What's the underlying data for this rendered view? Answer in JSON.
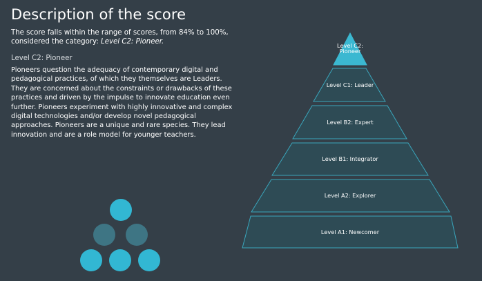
{
  "header": {
    "title": "Description of the score"
  },
  "intro": {
    "line1": "The score falls within the range of scores, from 84% to 100%,",
    "line2_prefix": "considered the category: ",
    "category": "Level C2: Pioneer."
  },
  "level": {
    "heading": "Level C2: Pioneer",
    "description": "Pioneers question the adequacy of contemporary digital and pedagogical practices, of which they themselves are Leaders. They are concerned about the constraints or drawbacks of these practices and driven by the impulse to innovate education even further. Pioneers experiment with highly innovative and complex digital technologies and/or develop novel pedagogical approaches. Pioneers are a unique and rare species. They lead innovation and are a role model for younger teachers."
  },
  "pyramid": {
    "apex_line1": "Level C2:",
    "apex_line2": "Pioneer",
    "levels": [
      "Level C1: Leader",
      "Level B2: Expert",
      "Level B1: Integrator",
      "Level A2: Explorer",
      "Level A1: Newcomer"
    ],
    "highlight_color": "#3bb8d1",
    "band_color": "#2e4b55"
  },
  "logo": {
    "icon": "circles-pyramid-icon",
    "bright_color": "#32b7d3",
    "dark_color": "#3e7584"
  }
}
